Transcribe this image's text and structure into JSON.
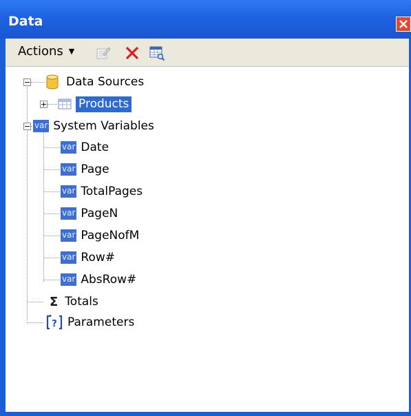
{
  "window": {
    "title": "Data"
  },
  "toolbar": {
    "actions_label": "Actions",
    "buttons": [
      "edit-icon",
      "delete-icon",
      "view-data-icon"
    ]
  },
  "tree": {
    "data_sources": {
      "label": "Data Sources",
      "children": [
        {
          "label": "Products",
          "selected": true
        }
      ]
    },
    "system_variables": {
      "label": "System Variables",
      "icon_text": "var",
      "children": [
        "Date",
        "Page",
        "TotalPages",
        "PageN",
        "PageNofM",
        "Row#",
        "AbsRow#"
      ]
    },
    "totals": {
      "label": "Totals"
    },
    "parameters": {
      "label": "Parameters"
    }
  },
  "colors": {
    "title_bar": "#1d62e1",
    "selection": "#2e6bd1",
    "toolbar": "#ebe9dc",
    "close": "#e04a2e"
  }
}
